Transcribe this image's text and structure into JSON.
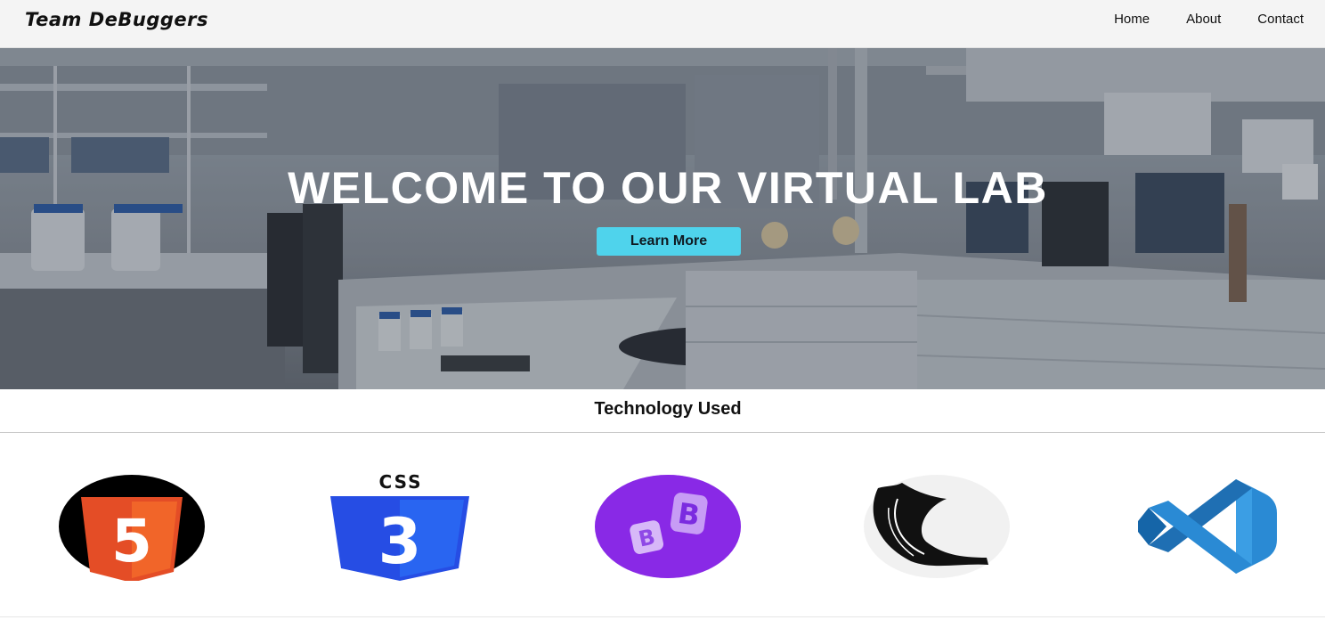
{
  "navbar": {
    "brand": "Team DeBuggers",
    "links": [
      "Home",
      "About",
      "Contact"
    ]
  },
  "hero": {
    "title": "WELCOME TO OUR VIRTUAL LAB",
    "button_label": "Learn More",
    "button_color": "#4fd3ec"
  },
  "technology": {
    "title": "Technology Used",
    "logos": [
      {
        "icon": "html5-icon",
        "badge_text": "5"
      },
      {
        "icon": "css3-icon",
        "badge_text": "CSS"
      },
      {
        "icon": "bootstrap-icon",
        "badge_text": "B"
      },
      {
        "icon": "flask-icon"
      },
      {
        "icon": "vscode-icon"
      }
    ]
  },
  "colors": {
    "html5": "#e44d26",
    "css3": "#264de4",
    "bootstrap": "#7952b3",
    "vscode": "#2a8ad4"
  }
}
